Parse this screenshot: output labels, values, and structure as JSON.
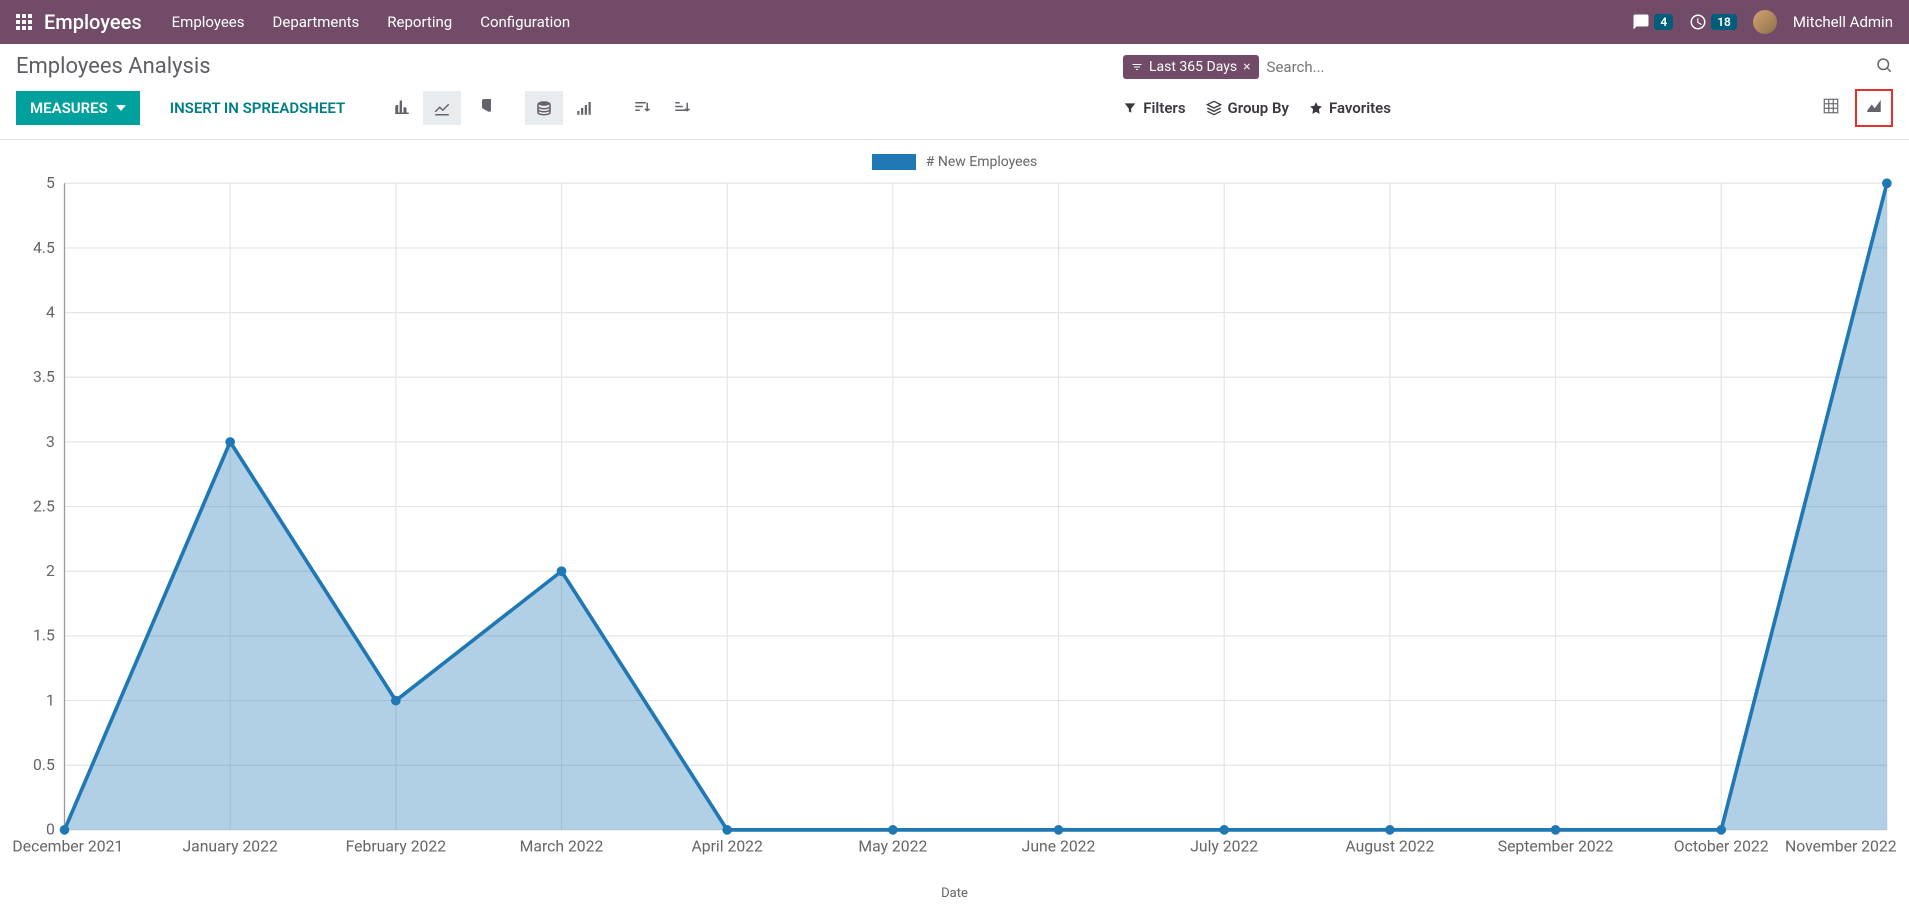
{
  "nav": {
    "app_title": "Employees",
    "items": [
      "Employees",
      "Departments",
      "Reporting",
      "Configuration"
    ],
    "msg_badge": "4",
    "activity_badge": "18",
    "user_name": "Mitchell Admin"
  },
  "page": {
    "title": "Employees Analysis"
  },
  "search": {
    "filter_label": "Last 365 Days",
    "placeholder": "Search..."
  },
  "toolbar": {
    "measures_label": "MEASURES",
    "insert_label": "INSERT IN SPREADSHEET",
    "filters_label": "Filters",
    "groupby_label": "Group By",
    "favorites_label": "Favorites"
  },
  "chart_legend": {
    "series1": "# New Employees"
  },
  "chart_data": {
    "type": "area",
    "title": "",
    "xlabel": "Date",
    "ylabel": "",
    "ylim": [
      0,
      5
    ],
    "yticks": [
      0,
      0.5,
      1,
      1.5,
      2,
      2.5,
      3,
      3.5,
      4,
      4.5,
      5
    ],
    "categories": [
      "December 2021",
      "January 2022",
      "February 2022",
      "March 2022",
      "April 2022",
      "May 2022",
      "June 2022",
      "July 2022",
      "August 2022",
      "September 2022",
      "October 2022",
      "November 2022"
    ],
    "series": [
      {
        "name": "# New Employees",
        "values": [
          0,
          3,
          1,
          2,
          0,
          0,
          0,
          0,
          0,
          0,
          0,
          5
        ],
        "color": "#1f77b4"
      }
    ]
  }
}
